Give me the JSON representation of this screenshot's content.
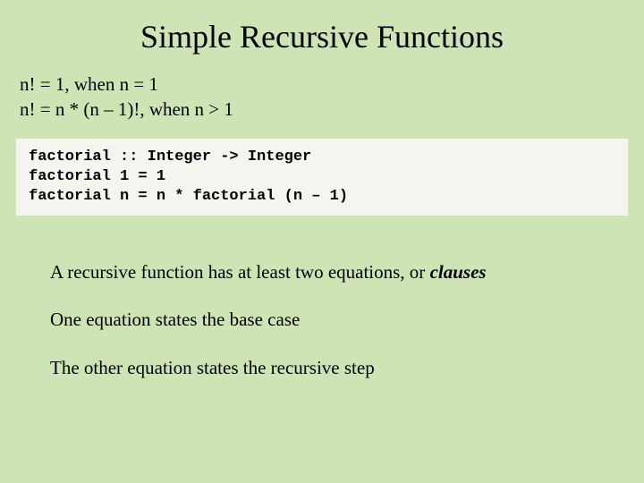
{
  "title": "Simple Recursive Functions",
  "math": {
    "line1": "n! = 1, when n = 1",
    "line2": "n! = n * (n – 1)!, when n > 1"
  },
  "code": {
    "line1": "factorial :: Integer -> Integer",
    "line2": "factorial 1 = 1",
    "line3": "factorial n = n * factorial (n – 1)"
  },
  "body": {
    "p1_a": "A recursive function has at least two equations, or ",
    "p1_b": "clauses",
    "p2": "One equation states the base case",
    "p3": "The other equation states the recursive step"
  }
}
